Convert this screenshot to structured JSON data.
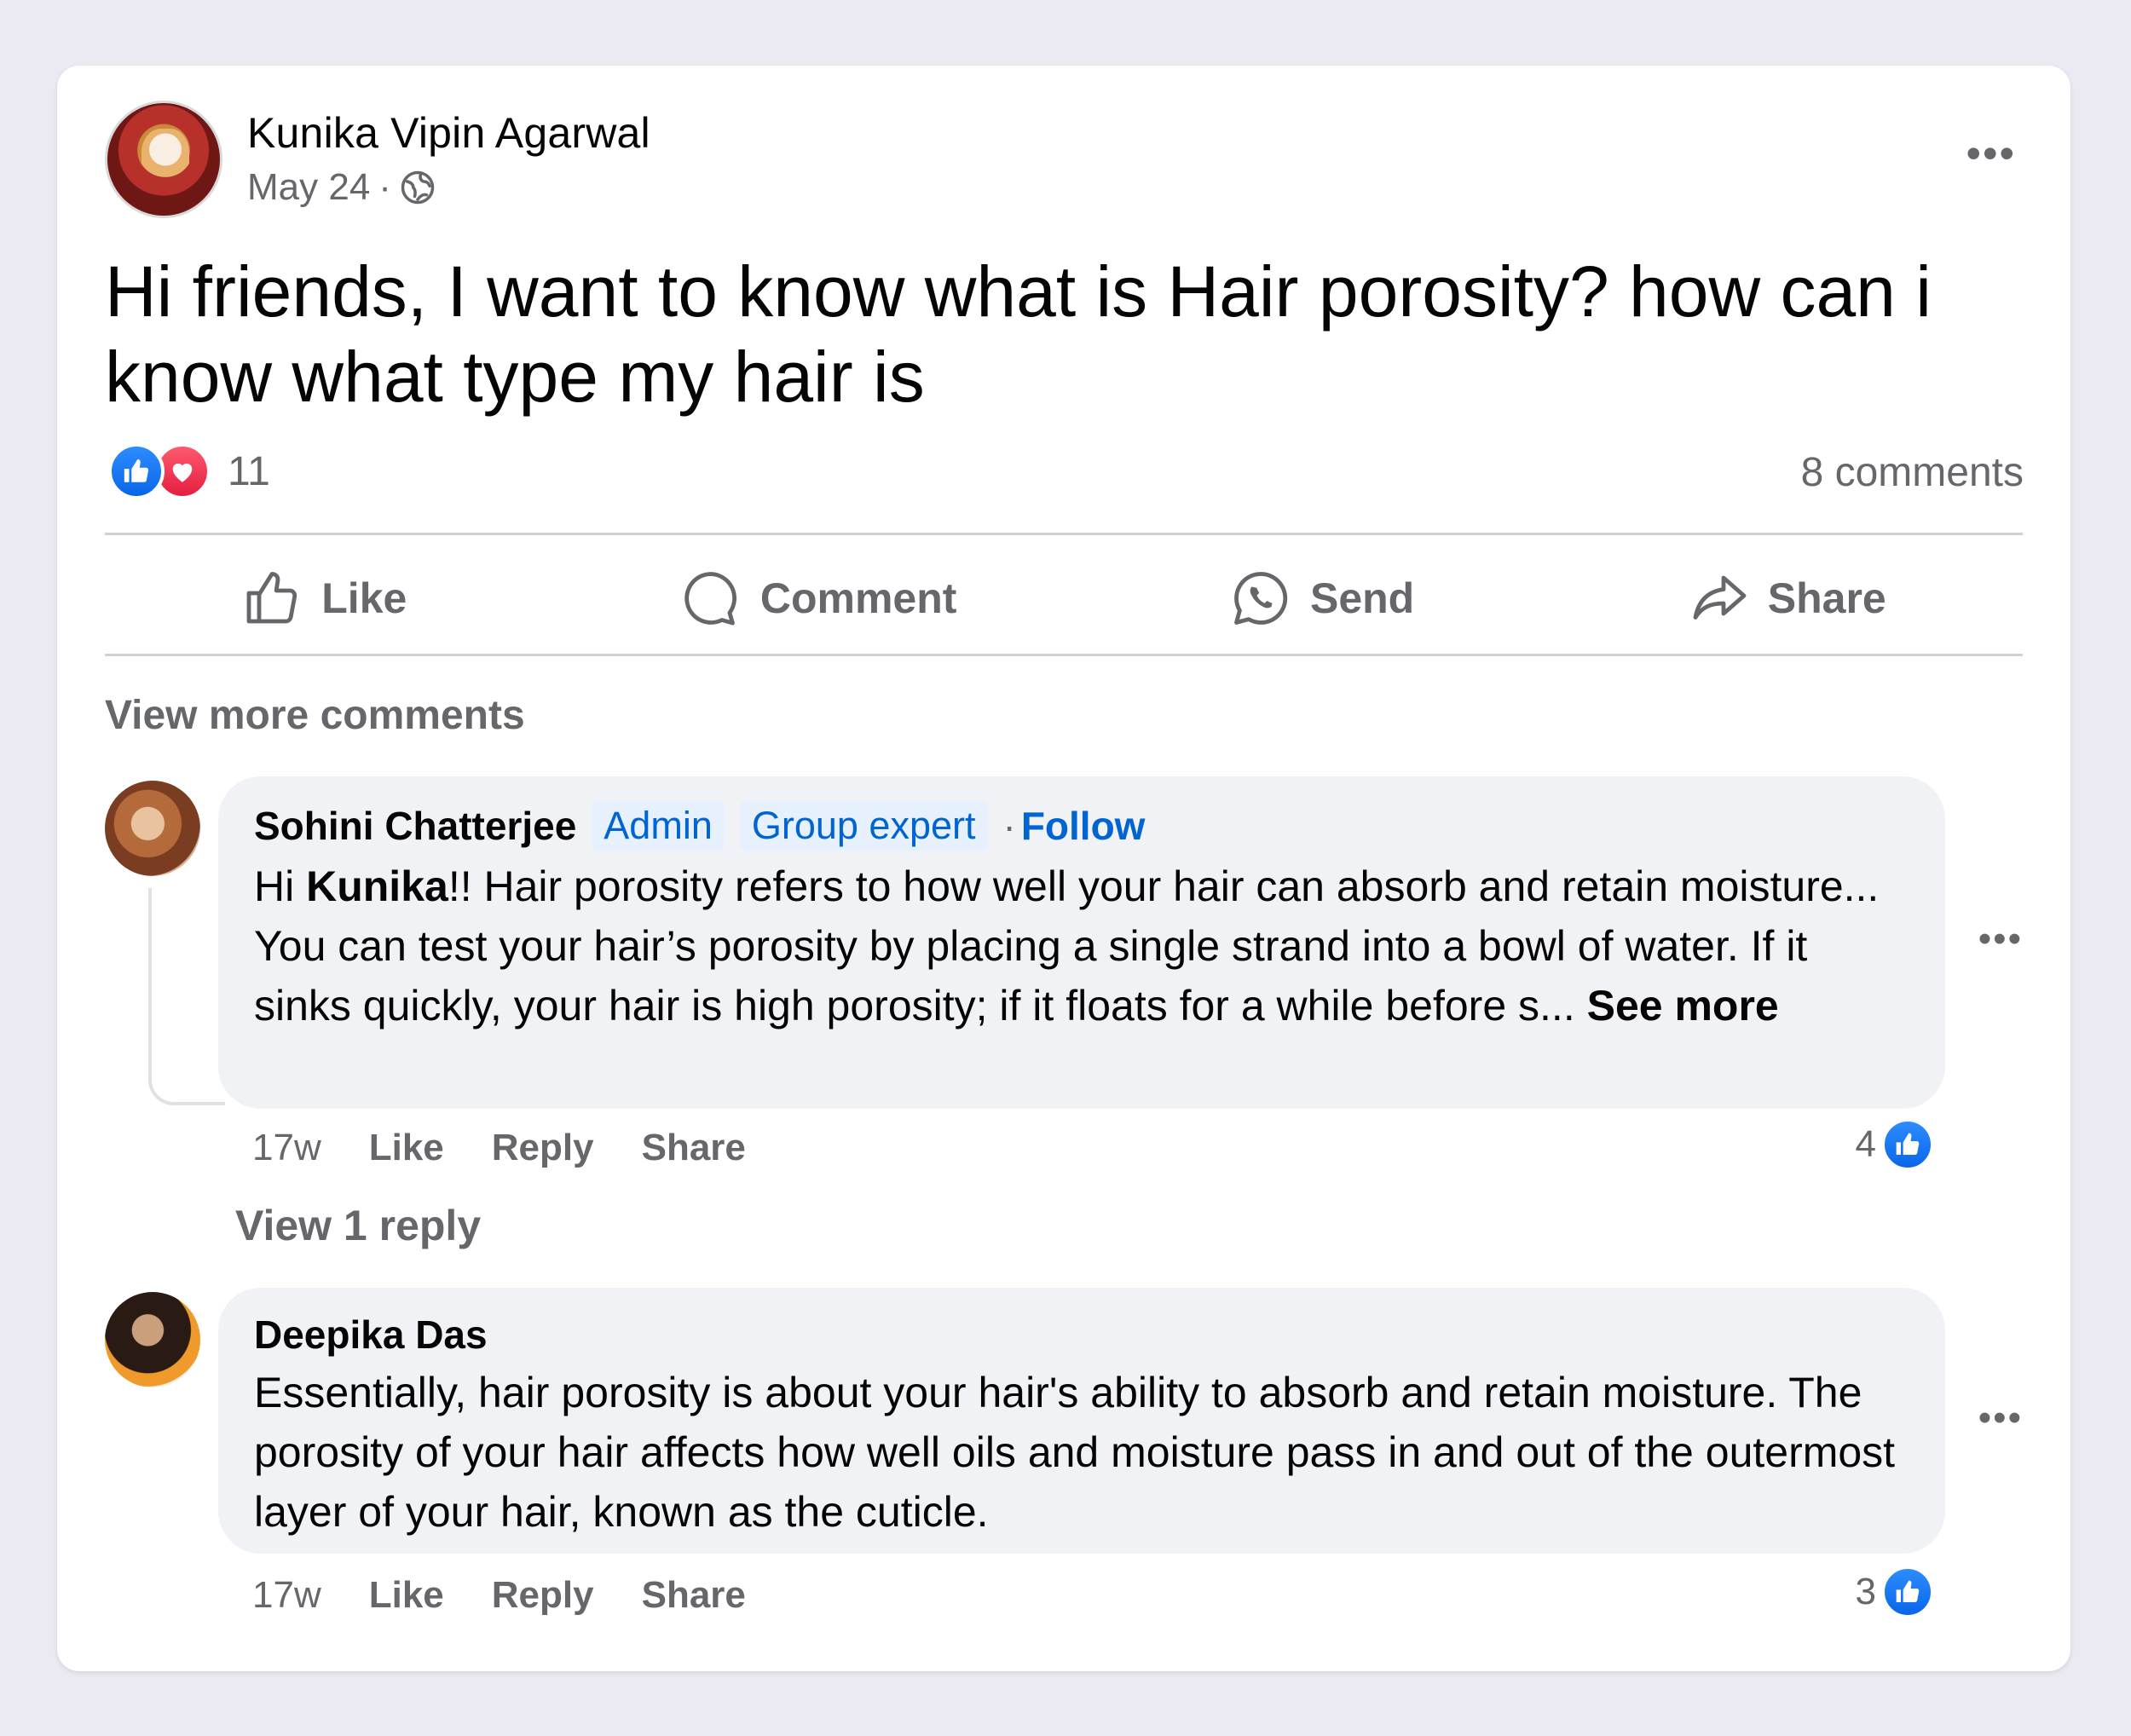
{
  "post": {
    "author": "Kunika Vipin Agarwal",
    "date": "May 24",
    "separator": "·",
    "privacy_icon": "globe-icon",
    "more_label": "•••",
    "text": "Hi friends, I want to know what is Hair porosity? how can i know what type my hair is",
    "reactions_count": "11",
    "reaction_icons": [
      "like-icon",
      "love-icon"
    ],
    "comments_count": "8 comments"
  },
  "actions": {
    "like": "Like",
    "comment": "Comment",
    "send": "Send",
    "share": "Share"
  },
  "view_more_comments": "View more comments",
  "comments": [
    {
      "name": "Sohini Chatterjee",
      "badges": [
        "Admin",
        "Group expert"
      ],
      "follow": "Follow",
      "dot": "·",
      "text_intro_pre": "Hi ",
      "text_intro_bold": "Kunika",
      "text_intro_post": "!! Hair porosity refers to how well your hair can absorb and retain moisture...",
      "text_body": "You can test your hair’s porosity by placing a single strand into a bowl of water. If it sinks quickly, your hair is high porosity; if it floats for a while before s... ",
      "see_more": "See more",
      "time": "17w",
      "like": "Like",
      "reply": "Reply",
      "share": "Share",
      "reaction_count": "4",
      "more_label": "•••"
    },
    {
      "name": "Deepika Das",
      "text": "Essentially, hair porosity is about your hair's ability to absorb and retain moisture. The porosity of your hair affects how well oils and moisture pass in and out of the outermost layer of your hair, known as the cuticle.",
      "time": "17w",
      "like": "Like",
      "reply": "Reply",
      "share": "Share",
      "reaction_count": "3",
      "more_label": "•••"
    }
  ],
  "view_reply": "View 1 reply",
  "colors": {
    "background": "#ebeaf2",
    "card": "#ffffff",
    "bubble": "#f0f2f5",
    "secondary_text": "#65676b",
    "link_blue": "#0064d1",
    "like_blue": "#0a66e8",
    "love_red": "#e41e3f"
  }
}
